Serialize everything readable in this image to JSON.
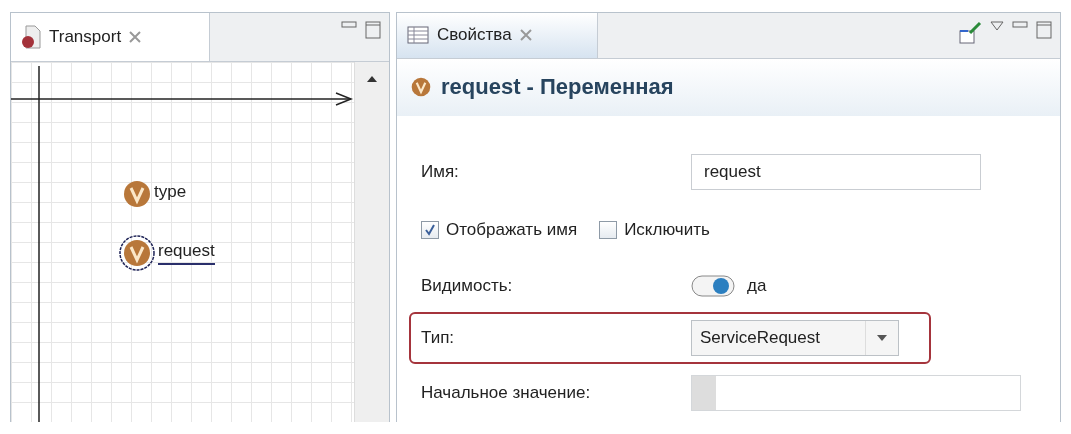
{
  "left_panel": {
    "tab": {
      "label": "Transport",
      "selected": true
    },
    "variables": [
      {
        "name": "type",
        "selected": false
      },
      {
        "name": "request",
        "selected": true
      }
    ]
  },
  "right_panel": {
    "tab": {
      "label": "Свойства",
      "selected": true
    },
    "title": "request - Переменная",
    "fields": [
      {
        "kind": "text",
        "label": "Имя:",
        "value": "request"
      },
      {
        "kind": "checks",
        "items": [
          {
            "label": "Отображать имя",
            "checked": true
          },
          {
            "label": "Исключить",
            "checked": false
          }
        ]
      },
      {
        "kind": "toggle",
        "label": "Видимость:",
        "on": true,
        "value": "да"
      },
      {
        "kind": "combo",
        "label": "Тип:",
        "value": "ServiceRequest",
        "highlighted": true
      },
      {
        "kind": "empty",
        "label": "Начальное значение:"
      }
    ]
  }
}
